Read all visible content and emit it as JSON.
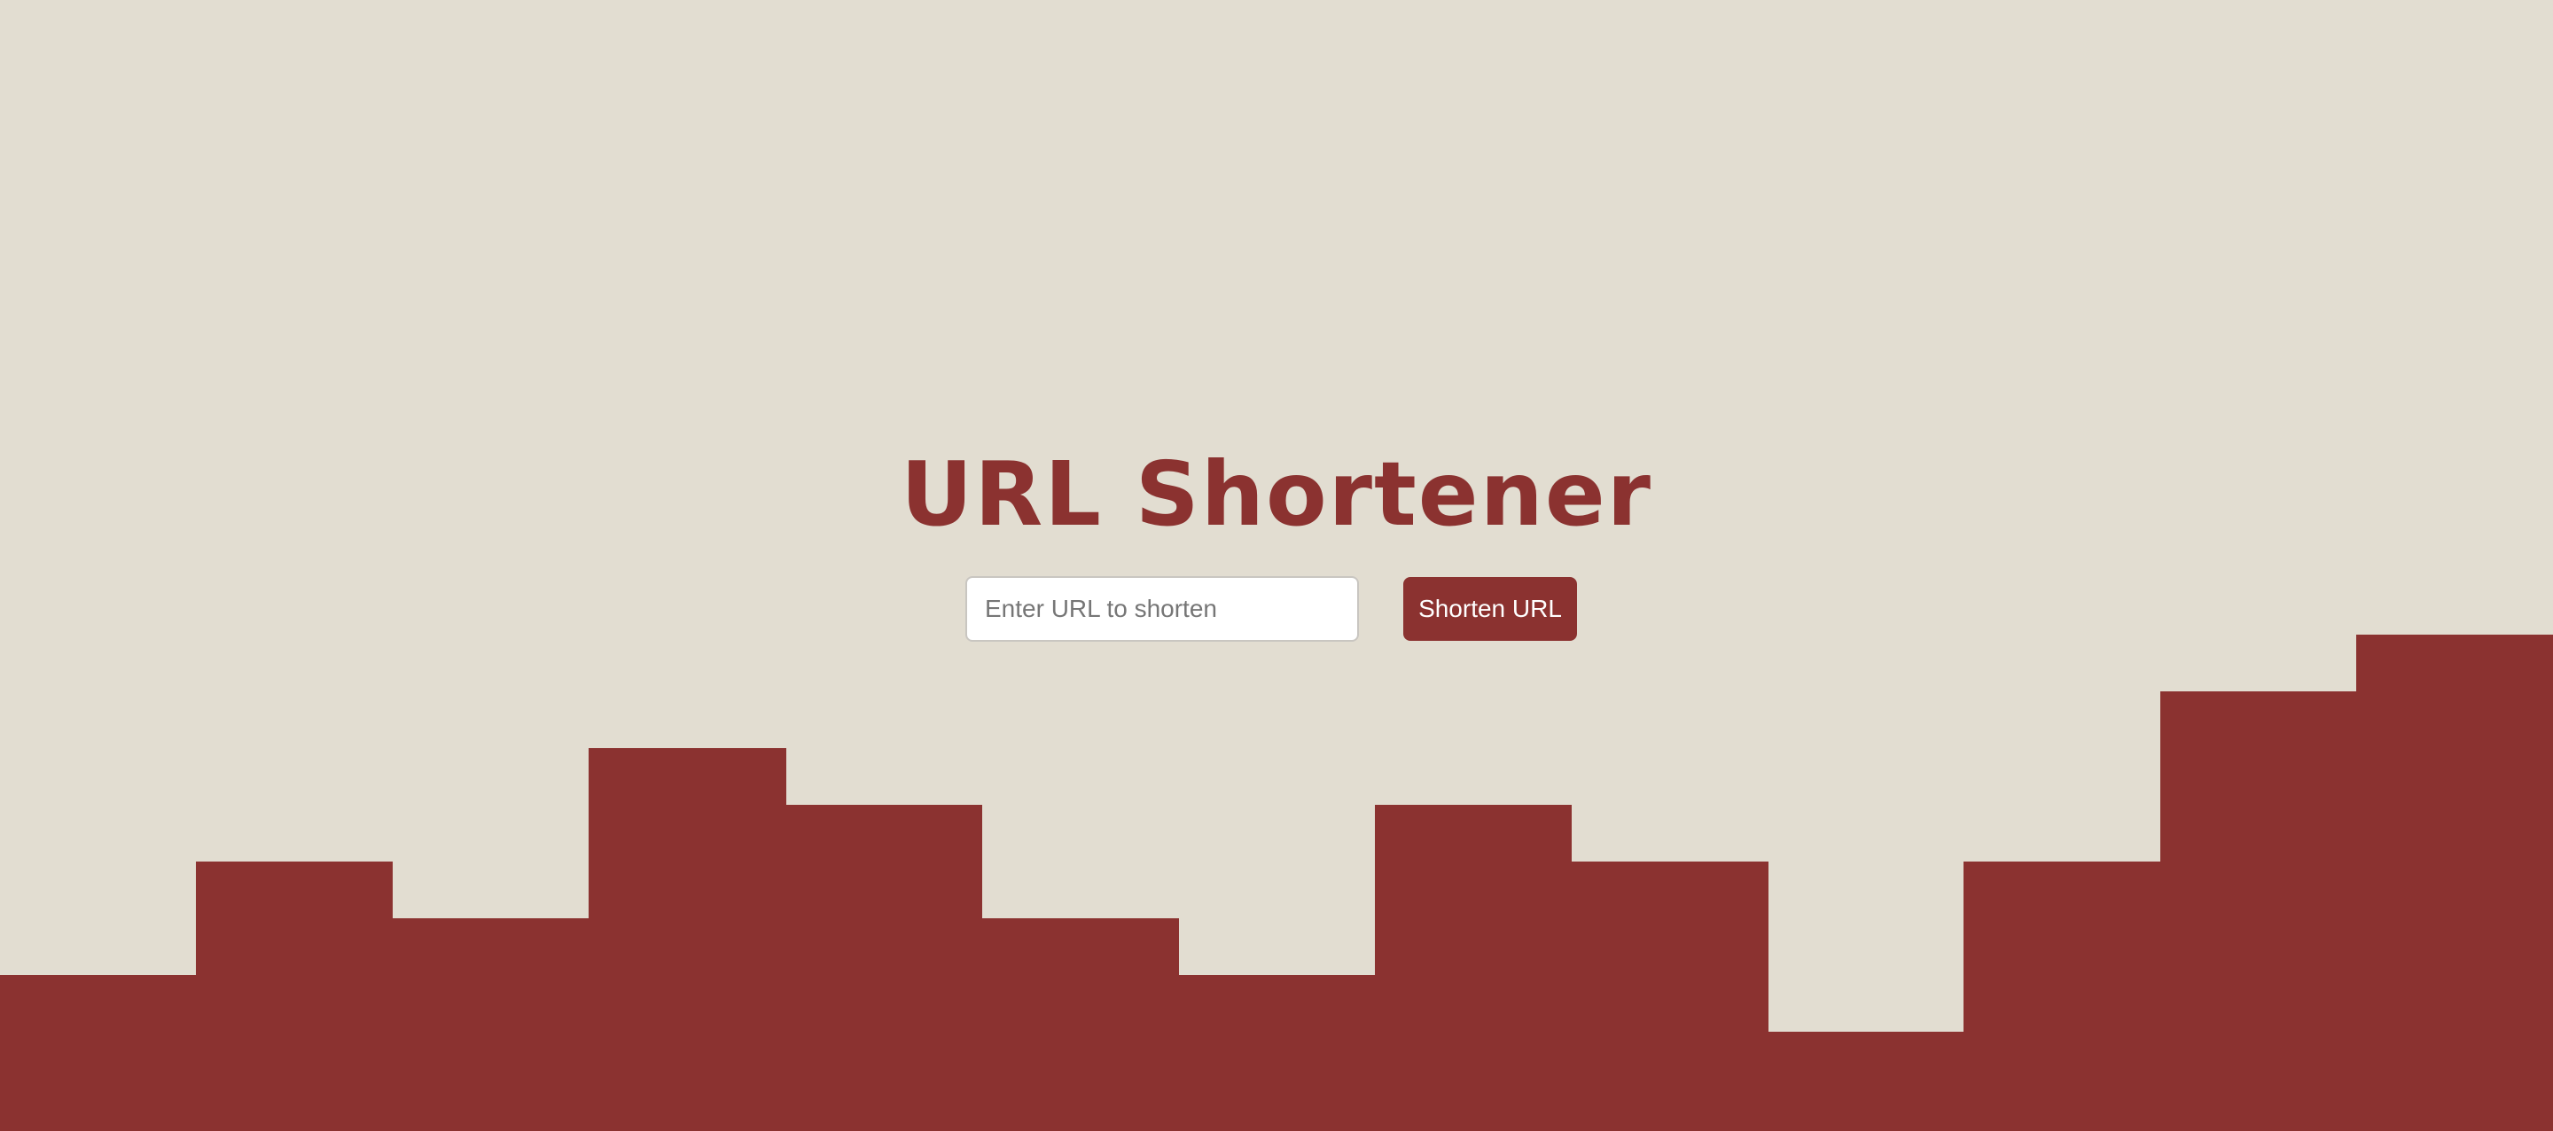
{
  "page": {
    "title": "URL Shortener"
  },
  "form": {
    "url_placeholder": "Enter URL to shorten",
    "url_value": "",
    "submit_label": "Shorten URL"
  },
  "theme": {
    "background": "#e2ddd1",
    "accent": "#8b3230",
    "input_background": "#ffffff"
  }
}
